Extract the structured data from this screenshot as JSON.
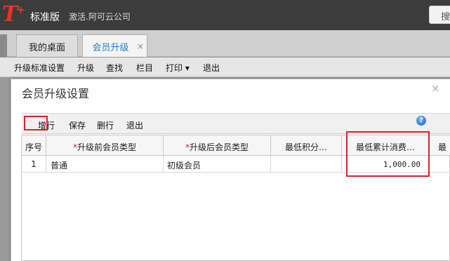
{
  "app": {
    "logo_text": "T",
    "logo_plus": "+",
    "edition": "标准版",
    "activate_text": "激活.阿可云公司",
    "search_label": "搜"
  },
  "tabs": [
    {
      "label": "我的桌面",
      "active": false
    },
    {
      "label": "会员升级",
      "active": true,
      "close": "×"
    }
  ],
  "main_toolbar": [
    "升级标准设置",
    "升级",
    "查找",
    "栏目",
    "打印 ▾",
    "退出"
  ],
  "dialog": {
    "title": "会员升级设置",
    "close": "×",
    "toolbar": [
      "增行",
      "保存",
      "删行",
      "退出"
    ],
    "help": "?"
  },
  "grid": {
    "columns": [
      {
        "label": "序号",
        "required": false
      },
      {
        "label": "升级前会员类型",
        "required": true
      },
      {
        "label": "升级后会员类型",
        "required": true
      },
      {
        "label": "最低积分…",
        "required": false
      },
      {
        "label": "最低累计消费…",
        "required": false
      },
      {
        "label": "最",
        "required": false
      }
    ],
    "rows": [
      {
        "index": "1",
        "before": "普通",
        "after": "初级会员",
        "min_points": "",
        "min_spend": "1,000.00"
      }
    ],
    "required_mark": "*"
  },
  "colors": {
    "accent_blue": "#2a7fc8",
    "highlight_red": "#e0202a",
    "logo_red": "#e8342b"
  }
}
